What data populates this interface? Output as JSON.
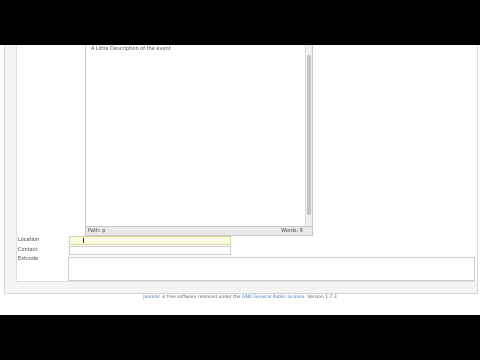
{
  "editor": {
    "content": "A Little Description of the event",
    "status_path": "Path: p",
    "status_words": "Words: 6"
  },
  "form": {
    "location_label": "Location",
    "location_value": "",
    "contact_label": "Contact",
    "contact_value": "",
    "extcode_label": "Extcode",
    "extcode_value": ""
  },
  "footer": {
    "brand": "Joomla!",
    "text1": " is free software released under the ",
    "license": "GNU General Public License",
    "text2": ".   Version 1.7.3"
  },
  "colors": {
    "link": "#4a76b5",
    "focus_field": "#fbfbe0"
  }
}
